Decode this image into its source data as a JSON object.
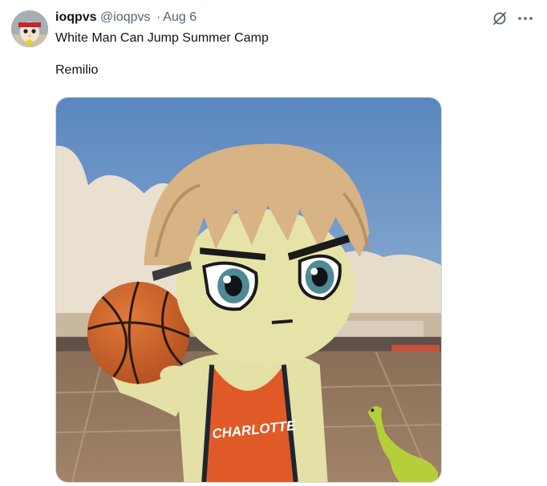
{
  "tweet": {
    "author_name": "ioqpvs",
    "author_handle": "@ioqpvs",
    "separator": "·",
    "date": "Aug 6",
    "text": "White Man Can Jump Summer Camp\n\nRemilio"
  },
  "media": {
    "jersey_text": "CHARLOTTE"
  },
  "icons": {
    "grok": "grok-icon",
    "more": "more-icon"
  },
  "colors": {
    "name": "#0f1419",
    "secondary": "#536471",
    "jersey": "#e05a28"
  }
}
